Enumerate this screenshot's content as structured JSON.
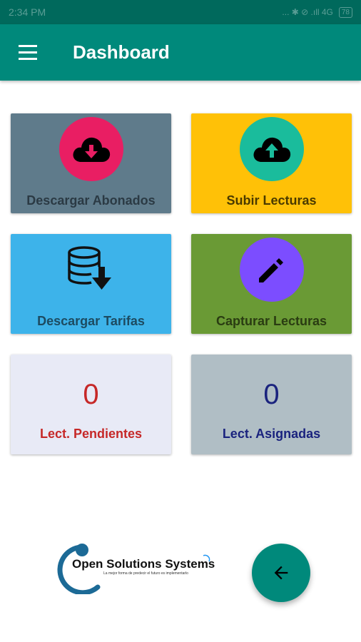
{
  "status_bar": {
    "time": "2:34 PM",
    "indicators": "... ✱ ⊘ .ıll 4G",
    "battery": "78"
  },
  "app_bar": {
    "title": "Dashboard",
    "menu_icon": "hamburger-menu-icon"
  },
  "tiles": [
    {
      "label": "Descargar Abonados",
      "icon": "cloud-download-icon",
      "bg": "#5f7b8b",
      "icon_bg": "#e91e63",
      "text_color": "#2b3a44"
    },
    {
      "label": "Subir Lecturas",
      "icon": "cloud-upload-icon",
      "bg": "#ffc107",
      "icon_bg": "#1abc9c",
      "text_color": "#4a3a00"
    },
    {
      "label": "Descargar Tarifas",
      "icon": "database-download-icon",
      "bg": "#3db3ea",
      "text_color": "#1d4b61"
    },
    {
      "label": "Capturar Lecturas",
      "icon": "pencil-icon",
      "bg": "#6a9a35",
      "icon_bg": "#7c4dff",
      "text_color": "#2a3c12"
    }
  ],
  "counters": [
    {
      "value": "0",
      "label": "Lect. Pendientes",
      "bg": "#e8eaf6",
      "color": "#c62828"
    },
    {
      "value": "0",
      "label": "Lect. Asignadas",
      "bg": "#b0bec5",
      "color": "#1a237e"
    }
  ],
  "logo": {
    "name": "Open Solutions Systems",
    "tagline": "La mejor forma de predecir el futuro es implementarlo"
  },
  "fab": {
    "icon": "arrow-back-icon"
  }
}
